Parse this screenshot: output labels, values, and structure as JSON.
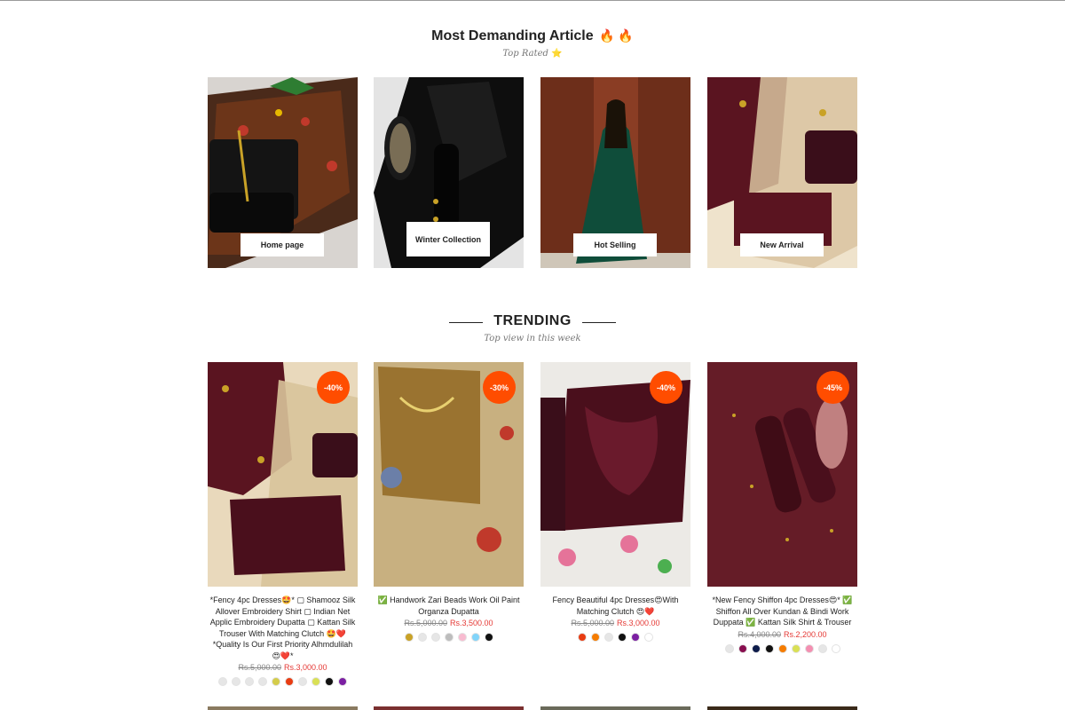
{
  "featured": {
    "title": "Most Demanding Article",
    "title_icons": "🔥 🔥",
    "subtitle": "Top Rated",
    "subtitle_icon": "⭐",
    "categories": [
      {
        "label": "Home page"
      },
      {
        "label": "Winter Collection"
      },
      {
        "label": "Hot Selling"
      },
      {
        "label": "New Arrival"
      }
    ]
  },
  "trending": {
    "title": "TRENDING",
    "subtitle": "Top view in this week",
    "products": [
      {
        "name": "*Fency 4pc Dresses🤩* ▢ Shamooz Silk Allover Embroidery Shirt ▢ Indian Net Applic Embroidery Dupatta ▢ Kattan Silk Trouser With Matching Clutch 🤩❤️ *Quality Is Our First Priority Alhmdulilah 😍❤️*",
        "old_price": "Rs.5,000.00",
        "new_price": "Rs.3,000.00",
        "discount": "-40%",
        "swatches": [
          "#e6e6e6",
          "#e6e6e6",
          "#e6e6e6",
          "#e6e6e6",
          "#d4cc4a",
          "#e83c12",
          "#e6e6e6",
          "#d9e055",
          "#111111",
          "#7b1fa2"
        ]
      },
      {
        "name": "✅ Handwork Zari Beads Work Oil Paint Organza Dupatta",
        "old_price": "Rs.5,000.00",
        "new_price": "Rs.3,500.00",
        "discount": "-30%",
        "swatches": [
          "#c9a227",
          "#e6e6e6",
          "#e6e6e6",
          "#bdbdbd",
          "#f8bbd0",
          "#81d4fa",
          "#111111"
        ]
      },
      {
        "name": "Fency Beautiful 4pc Dresses😍With Matching Clutch 😍❤️",
        "old_price": "Rs.5,000.00",
        "new_price": "Rs.3,000.00",
        "discount": "-40%",
        "swatches": [
          "#e83c12",
          "#f57c00",
          "#e6e6e6",
          "#111111",
          "#7b1fa2",
          "#ffffff"
        ]
      },
      {
        "name": "*New Fency Shiffon 4pc Dresses😍* ✅ Shiffon All Over Kundan & Bindi Work Duppata ✅ Kattan Silk Shirt & Trouser",
        "old_price": "Rs.4,000.00",
        "new_price": "Rs.2,200.00",
        "discount": "-45%",
        "swatches": [
          "#e6e6e6",
          "#880e4f",
          "#0d1b4a",
          "#111111",
          "#f57c00",
          "#d9e055",
          "#f48fb1",
          "#e6e6e6",
          "#ffffff"
        ]
      }
    ]
  }
}
